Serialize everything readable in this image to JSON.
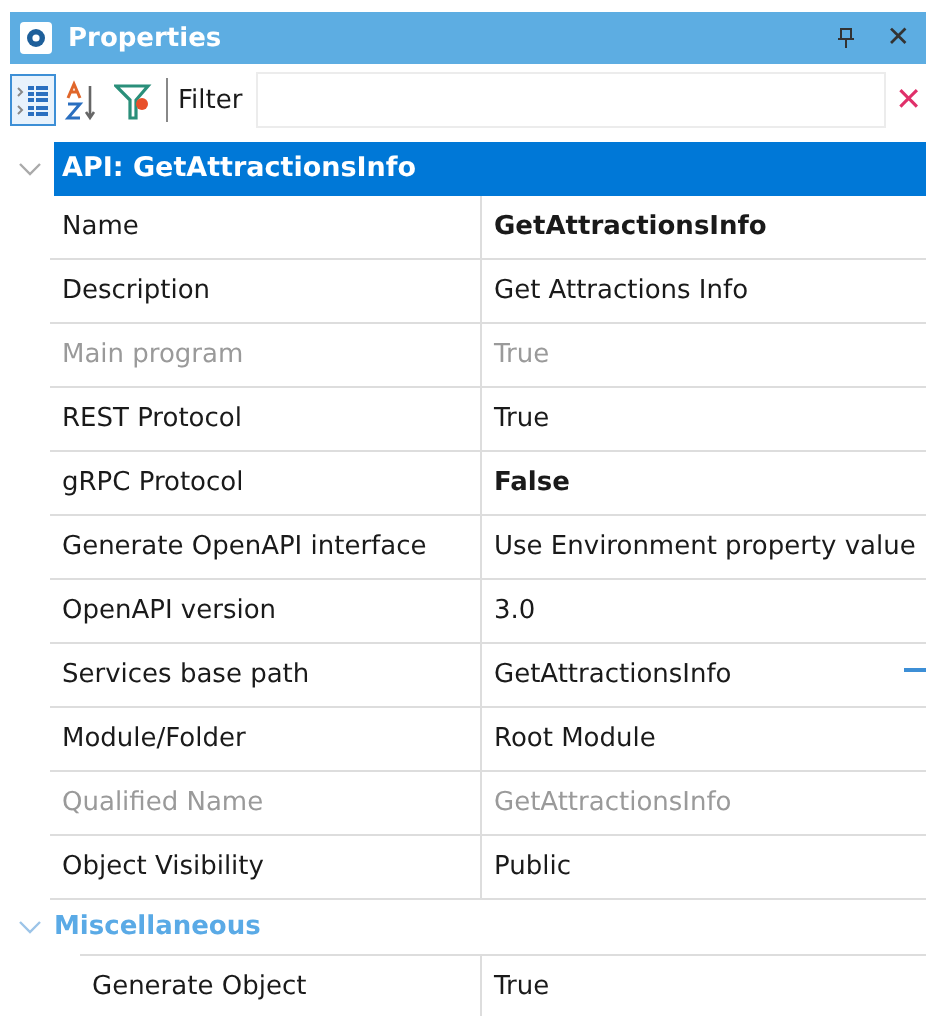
{
  "window": {
    "title": "Properties",
    "close": "✕"
  },
  "toolbar": {
    "buttons": [
      {
        "kind": "categorized",
        "selected": true
      },
      {
        "kind": "alphabetical",
        "selected": false
      },
      {
        "kind": "filter",
        "selected": false
      }
    ],
    "filter_label": "Filter",
    "clear": "✕"
  },
  "groups": [
    {
      "title": "API: GetAttractionsInfo",
      "kind": "main",
      "expanded": true,
      "rows": [
        {
          "name": "Name",
          "value": "GetAttractionsInfo",
          "disabled": false,
          "bold": true
        },
        {
          "name": "Description",
          "value": "Get Attractions Info",
          "disabled": false,
          "bold": false
        },
        {
          "name": "Main program",
          "value": "True",
          "disabled": true,
          "bold": false
        },
        {
          "name": "REST Protocol",
          "value": "True",
          "disabled": false,
          "bold": false
        },
        {
          "name": "gRPC Protocol",
          "value": "False",
          "disabled": false,
          "bold": true
        },
        {
          "name": "Generate OpenAPI interface",
          "value": "Use Environment property value",
          "disabled": false,
          "bold": false
        },
        {
          "name": "OpenAPI version",
          "value": "3.0",
          "disabled": false,
          "bold": false
        },
        {
          "name": "Services base path",
          "value": "GetAttractionsInfo",
          "disabled": false,
          "bold": false,
          "edit_button": true
        },
        {
          "name": "Module/Folder",
          "value": "Root Module",
          "disabled": false,
          "bold": false
        },
        {
          "name": "Qualified Name",
          "value": "GetAttractionsInfo",
          "disabled": true,
          "bold": false
        },
        {
          "name": "Object Visibility",
          "value": "Public",
          "disabled": false,
          "bold": false
        }
      ]
    },
    {
      "title": "Miscellaneous",
      "kind": "sub",
      "expanded": true,
      "rows": [
        {
          "name": "Generate Object",
          "value": "True",
          "disabled": false,
          "bold": false
        }
      ]
    }
  ]
}
